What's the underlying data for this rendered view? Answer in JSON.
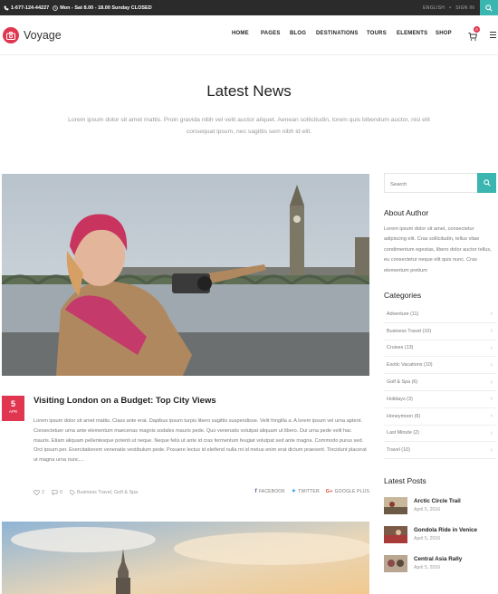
{
  "topbar": {
    "phone": "1-677-124-44227",
    "hours": "Mon - Sat 8.00 - 18.00 Sunday CLOSED",
    "language": "ENGLISH",
    "signin": "SIGN IN"
  },
  "header": {
    "logo_text": "Voyage",
    "nav": [
      "HOME",
      "PAGES",
      "BLOG",
      "DESTINATIONS",
      "TOURS",
      "ELEMENTS",
      "SHOP"
    ],
    "cart_count": "0"
  },
  "hero": {
    "title": "Latest News",
    "intro": "Lorem ipsum dolor sit amet mattis. Proin gravida nibh vel velit auctor aliquet. Aenean sollicitudin, lorem quis bibendum auctor, nisi elit consequat ipsum, nec sagittis sem nibh id elit."
  },
  "post": {
    "day": "5",
    "month": "APR",
    "title": "Visiting London on a Budget: Top City Views",
    "excerpt": "Lorem ipsum dolor sit amet mattis. Class ante erat. Dapibus ipsum turpis libero sagittis suspendisse. Velit fringilla a. A lorem ipsum vel urna aptent. Consectetuer urna ante elementum maecenas magnis sodales mauris pede. Quo venenatis volutpat aliquam ut libero. Dui urna pede velit hac mauris. Etiam aliquam pellentesque potenti ut neque. Neque felis ut ante id cras fermentum feugiat volutpat sed ante magna. Commodo purus sed. Orci ipsum per. Exercitationem venenatis vestibulum pede. Posuere lectus id eleifend nulla mi id metus enim erat dictum praesent. Tincidunt placerat ut magna urna nunc....",
    "likes": "2",
    "comments": "0",
    "categories": "Business Travel, Golf & Spa",
    "share": [
      "FACEBOOK",
      "TWITTER",
      "GOOGLE PLUS"
    ]
  },
  "sidebar": {
    "search_placeholder": "Search",
    "about_heading": "About Author",
    "about_text": "Lorem ipsum dolor sit amet, consectetur adipiscing elit. Cras sollicitudin, tellus vitae condimentum egestas, libero dolor auctor tellus, eu consectetur neque elit quis nunc. Cras elementum pretium",
    "categories_heading": "Categories",
    "categories": [
      "Adventure (11)",
      "Business Travel (10)",
      "Cruises (13)",
      "Exotic Vacations (10)",
      "Golf & Spa (6)",
      "Holidays (3)",
      "Honeymoon (6)",
      "Last Minute (2)",
      "Travel (10)"
    ],
    "latest_heading": "Latest Posts",
    "latest_posts": [
      {
        "title": "Arctic Circle Trail",
        "date": "April 5, 2016"
      },
      {
        "title": "Gondola Ride in Venice",
        "date": "April 5, 2016"
      },
      {
        "title": "Central Asia Rally",
        "date": "April 5, 2016"
      }
    ]
  },
  "colors": {
    "accent_teal": "#3ab5b0",
    "accent_red": "#e0364f",
    "topbar_bg": "#2b2b2b"
  }
}
